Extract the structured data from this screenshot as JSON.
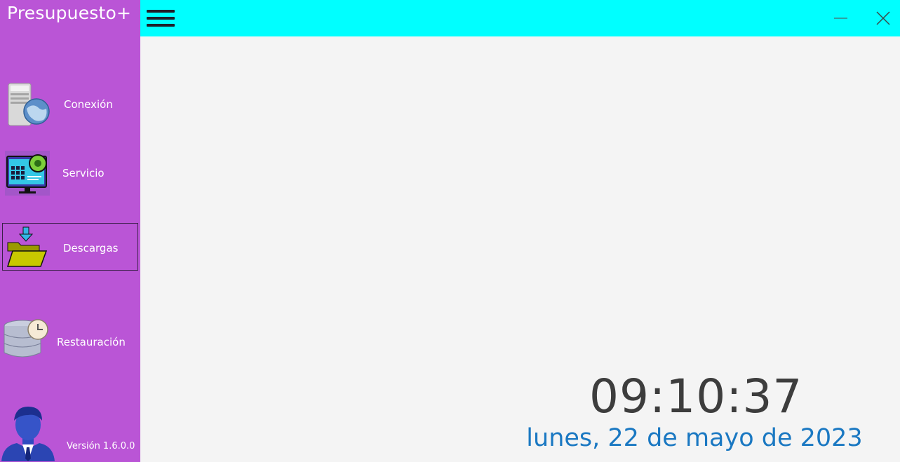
{
  "app": {
    "title": "Presupuesto+",
    "version": "Versión 1.6.0.0"
  },
  "sidebar": {
    "items": [
      {
        "label": "Conexión",
        "icon": "server-globe-icon"
      },
      {
        "label": "Servicio",
        "icon": "monitor-gear-icon"
      },
      {
        "label": "Descargas",
        "icon": "download-folder-icon",
        "active": true
      },
      {
        "label": "Restauración",
        "icon": "database-clock-icon"
      }
    ],
    "user_icon": "user-avatar-icon"
  },
  "topbar": {
    "menu_icon": "hamburger-menu-icon",
    "minimize_icon": "minimize-icon",
    "close_icon": "close-icon",
    "background": "#00ffff"
  },
  "main": {
    "time": "09:10:37",
    "date": "lunes, 22 de mayo de 2023"
  },
  "colors": {
    "sidebar": "#ba55d6",
    "time_text": "#3d3d3d",
    "date_text": "#1a78c2"
  }
}
